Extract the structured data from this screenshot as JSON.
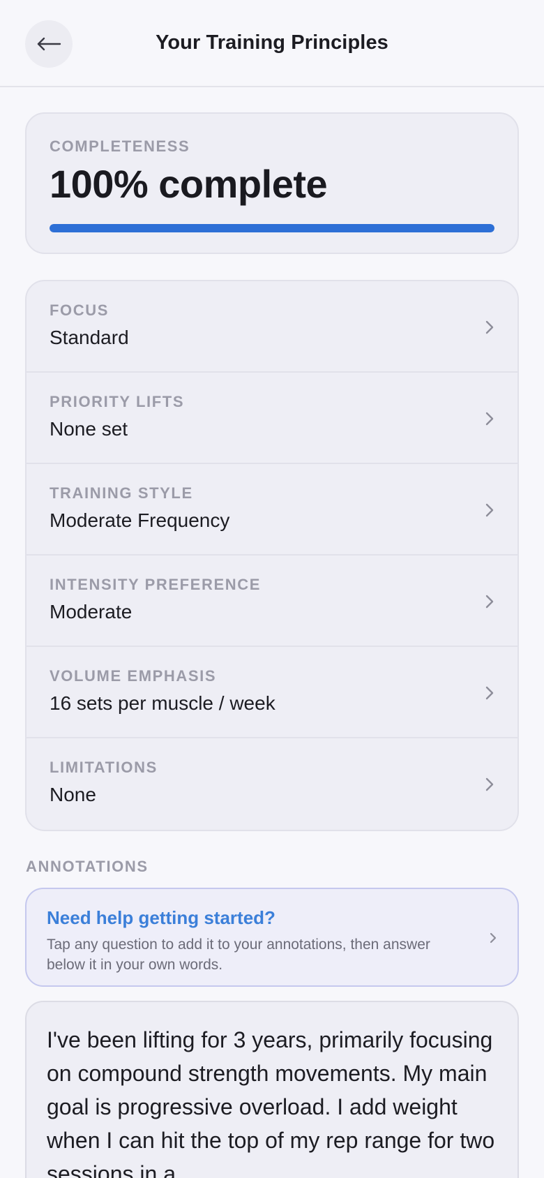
{
  "header": {
    "title": "Your Training Principles",
    "back_icon": "arrow-left-icon"
  },
  "completeness": {
    "label": "COMPLETENESS",
    "value_text": "100% complete",
    "progress_percent": 100,
    "bar_color": "#2d6fd6"
  },
  "principles": [
    {
      "label": "FOCUS",
      "value": "Standard"
    },
    {
      "label": "PRIORITY LIFTS",
      "value": "None set"
    },
    {
      "label": "TRAINING STYLE",
      "value": "Moderate Frequency"
    },
    {
      "label": "INTENSITY PREFERENCE",
      "value": "Moderate"
    },
    {
      "label": "VOLUME EMPHASIS",
      "value": "16 sets per muscle / week"
    },
    {
      "label": "LIMITATIONS",
      "value": "None"
    }
  ],
  "annotations": {
    "label": "ANNOTATIONS",
    "help": {
      "title": "Need help getting started?",
      "text": "Tap any question to add it to your annotations, then answer below it in your own words."
    },
    "text": "I've been lifting for 3 years, primarily focusing on compound strength movements. My main goal is progressive overload. I add weight when I can hit the top of my rep range for two sessions in a"
  },
  "colors": {
    "accent": "#3b7fd9",
    "background": "#f7f7fb"
  }
}
